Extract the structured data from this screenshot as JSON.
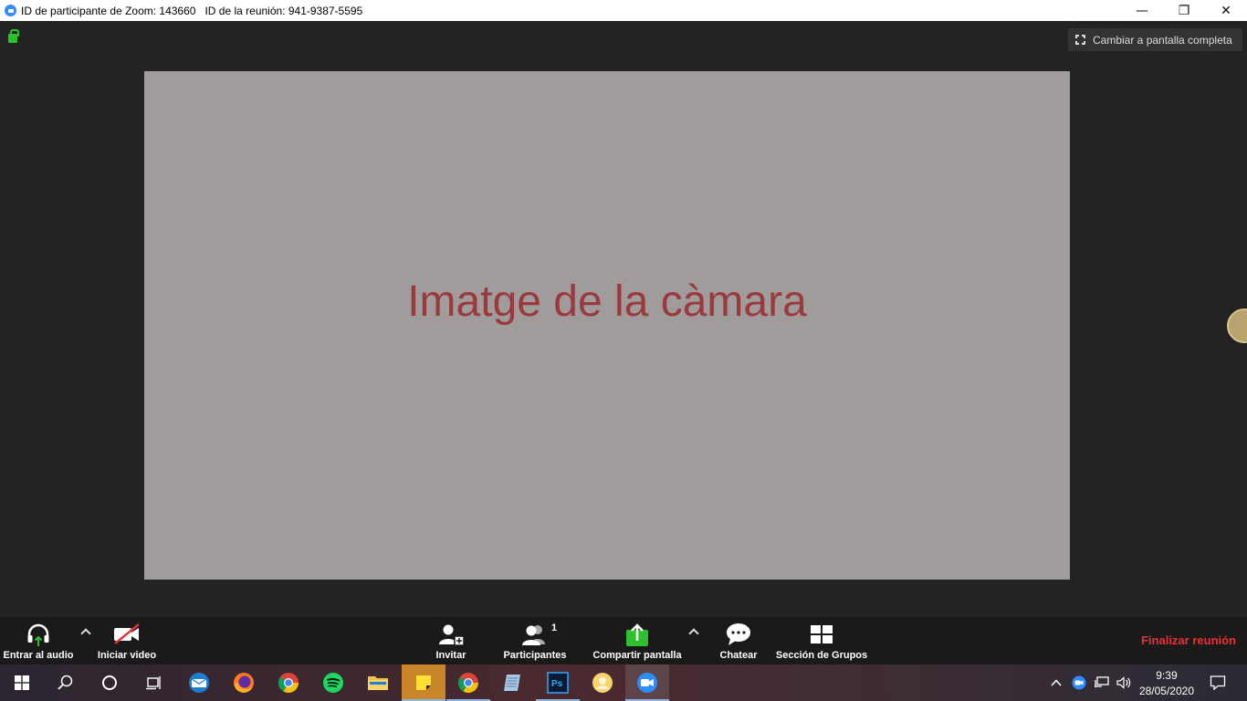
{
  "window": {
    "title": "ID de participante de Zoom: 143660   ID de la reunión: 941-9387-5595",
    "minimize": "—",
    "maximize": "❐",
    "close": "✕"
  },
  "meeting": {
    "fullscreen_label": "Cambiar a pantalla completa",
    "camera_caption": "Imatge de la càmara"
  },
  "toolbar": {
    "audio_label": "Entrar al audio",
    "video_label": "Iniciar video",
    "invite_label": "Invitar",
    "participants_label": "Participantes",
    "participants_count": "1",
    "share_label": "Compartir pantalla",
    "chat_label": "Chatear",
    "breakout_label": "Sección de Grupos",
    "end_label": "Finalizar reunión"
  },
  "taskbar": {
    "time": "9:39",
    "date": "28/05/2020",
    "apps": [
      "start-icon",
      "search-icon",
      "cortana-icon",
      "task-view-icon",
      "outlook-icon",
      "firefox-icon",
      "chrome-icon",
      "spotify-icon",
      "file-explorer-icon",
      "sticky-notes-icon",
      "chrome-icon",
      "notepad-icon",
      "photoshop-icon",
      "user-app-icon",
      "zoom-icon"
    ]
  },
  "colors": {
    "accent_green": "#2ec12e",
    "end_red": "#e8323a",
    "caption_red": "#9b3a3e",
    "zoom_blue": "#2d8cff"
  }
}
